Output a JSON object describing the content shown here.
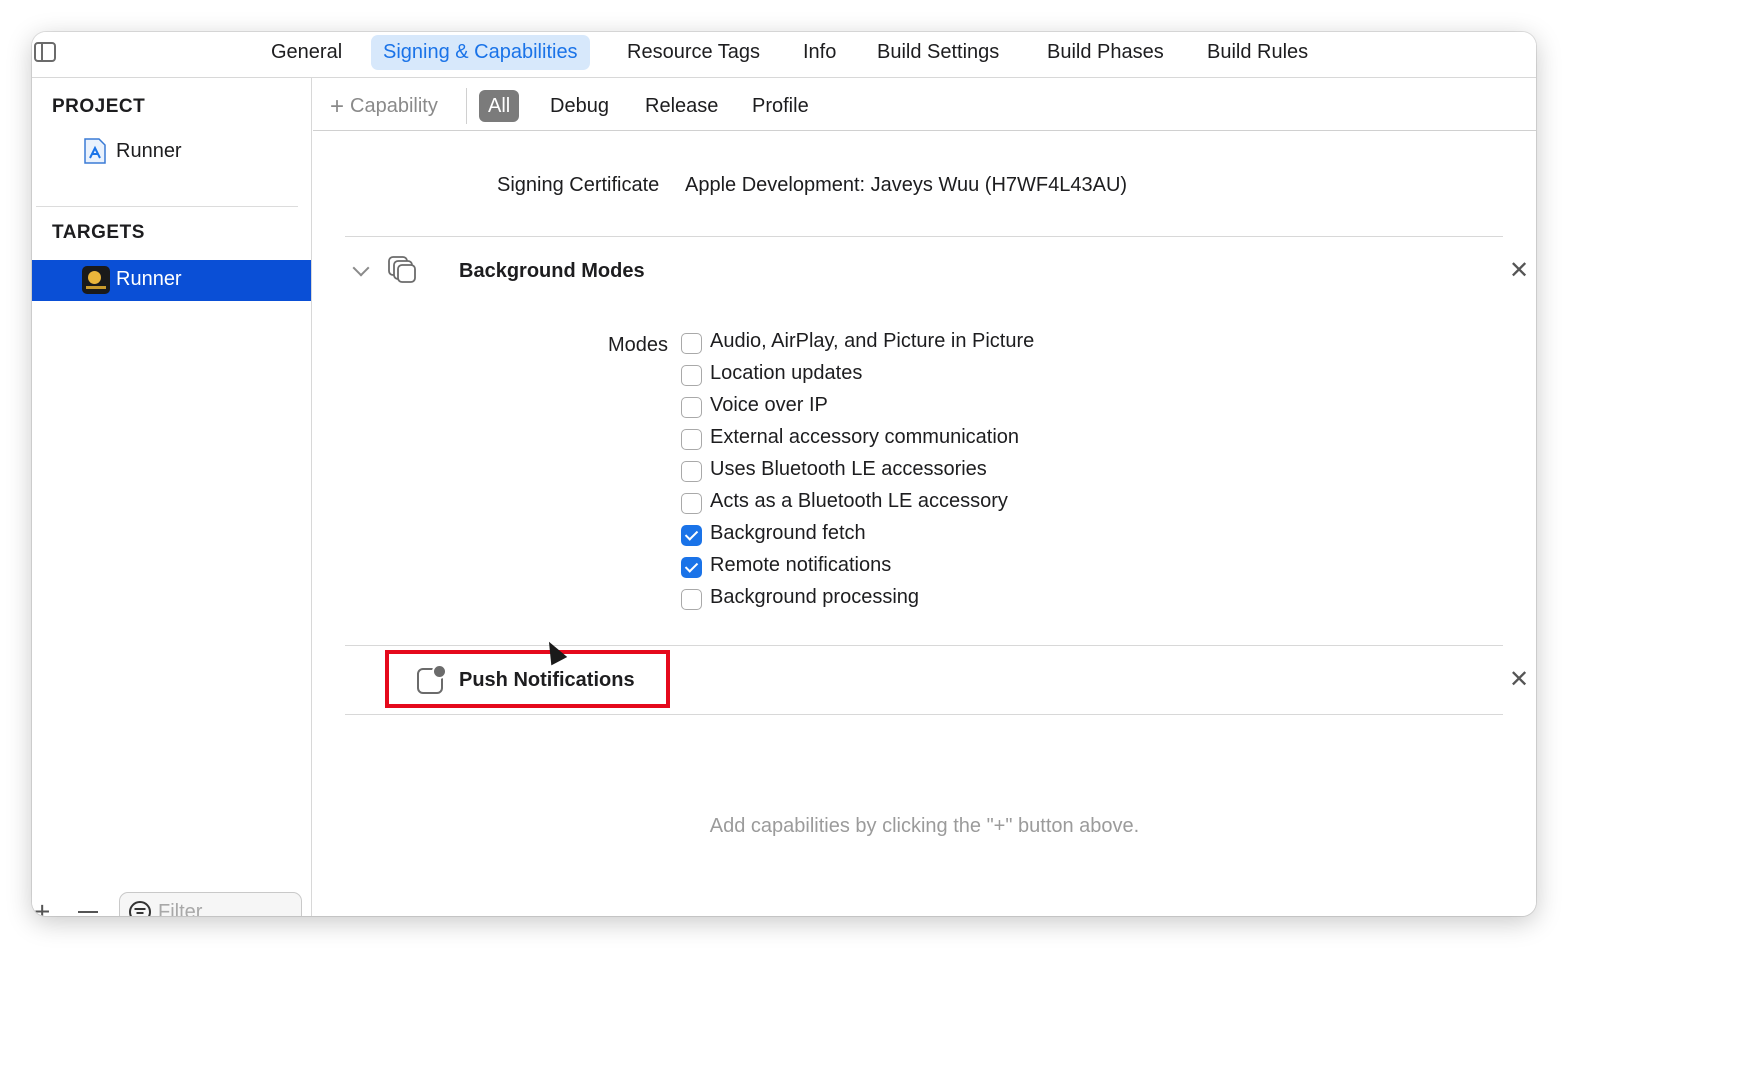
{
  "tabs": [
    {
      "label": "General",
      "active": false
    },
    {
      "label": "Signing & Capabilities",
      "active": true
    },
    {
      "label": "Resource Tags",
      "active": false
    },
    {
      "label": "Info",
      "active": false
    },
    {
      "label": "Build Settings",
      "active": false
    },
    {
      "label": "Build Phases",
      "active": false
    },
    {
      "label": "Build Rules",
      "active": false
    }
  ],
  "sidebar": {
    "project_header": "PROJECT",
    "project_item": "Runner",
    "targets_header": "TARGETS",
    "target_item": "Runner",
    "filter_placeholder": "Filter"
  },
  "filterbar": {
    "add_capability": "Capability",
    "segments": [
      "All",
      "Debug",
      "Release",
      "Profile"
    ],
    "selected": "All"
  },
  "signing": {
    "certificate_label": "Signing Certificate",
    "certificate_value": "Apple Development: Javeys Wuu (H7WF4L43AU)"
  },
  "background_modes": {
    "title": "Background Modes",
    "modes_label": "Modes",
    "modes": [
      {
        "label": "Audio, AirPlay, and Picture in Picture",
        "checked": false
      },
      {
        "label": "Location updates",
        "checked": false
      },
      {
        "label": "Voice over IP",
        "checked": false
      },
      {
        "label": "External accessory communication",
        "checked": false
      },
      {
        "label": "Uses Bluetooth LE accessories",
        "checked": false
      },
      {
        "label": "Acts as a Bluetooth LE accessory",
        "checked": false
      },
      {
        "label": "Background fetch",
        "checked": true
      },
      {
        "label": "Remote notifications",
        "checked": true
      },
      {
        "label": "Background processing",
        "checked": false
      }
    ]
  },
  "push_notifications": {
    "title": "Push Notifications"
  },
  "hint": "Add capabilities by clicking the \"+\" button above.",
  "colors": {
    "accent": "#1a73e8",
    "selection": "#0a4fd6",
    "highlight": "#e5091c"
  }
}
